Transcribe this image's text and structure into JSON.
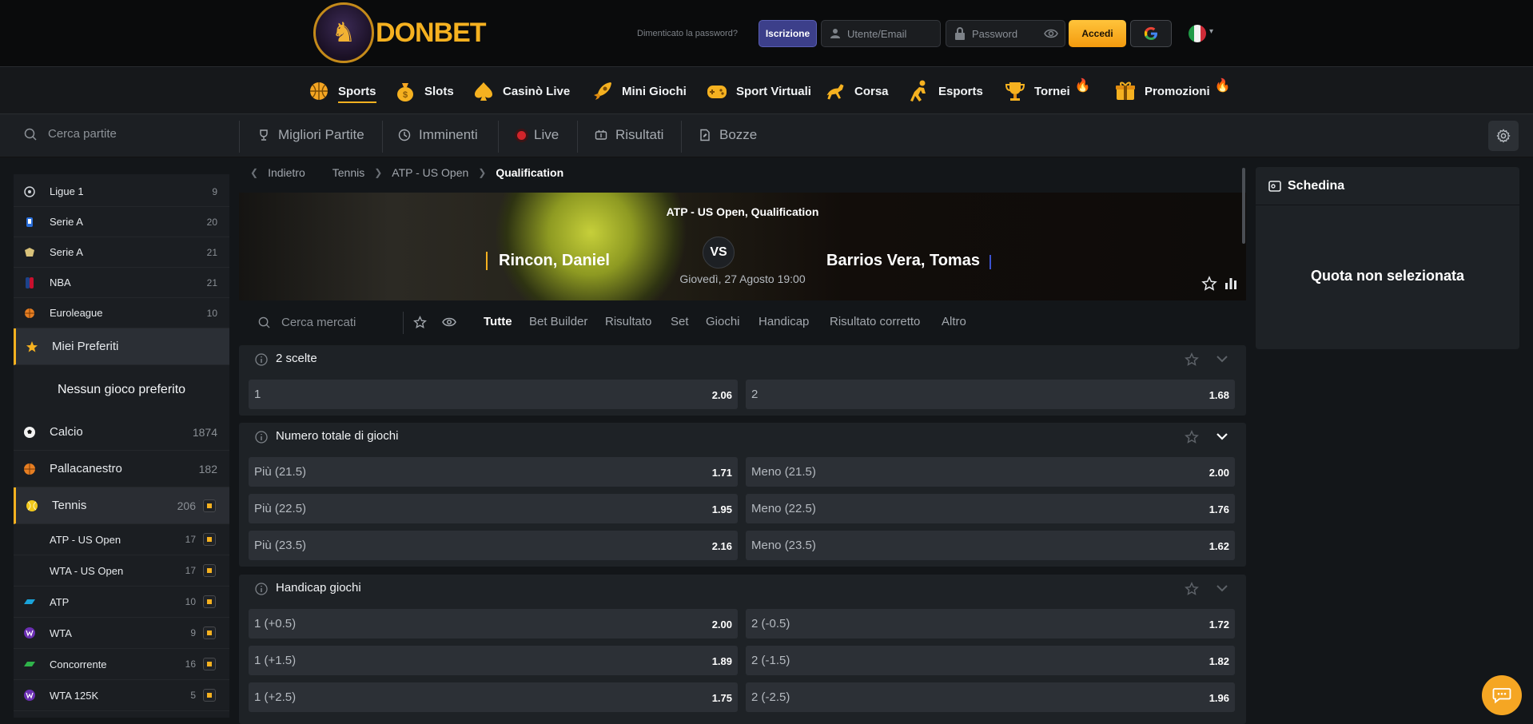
{
  "header": {
    "logo_text": "DONBET",
    "forgot_password": "Dimenticato la password?",
    "register_label": "Iscrizione",
    "user_placeholder": "Utente/Email",
    "password_placeholder": "Password",
    "login_label": "Accedi",
    "brand_color": "#f5b120"
  },
  "mainnav": {
    "items": [
      {
        "label": "Sports",
        "icon": "basketball-icon"
      },
      {
        "label": "Slots",
        "icon": "money-bag-icon"
      },
      {
        "label": "Casinò Live",
        "icon": "spade-icon"
      },
      {
        "label": "Mini Giochi",
        "icon": "rocket-icon"
      },
      {
        "label": "Sport Virtuali",
        "icon": "gamepad-icon"
      },
      {
        "label": "Corsa",
        "icon": "horse-icon"
      },
      {
        "label": "Esports",
        "icon": "player-icon"
      },
      {
        "label": "Tornei",
        "icon": "trophy-icon"
      },
      {
        "label": "Promozioni",
        "icon": "gift-icon"
      }
    ]
  },
  "subnav": {
    "search_placeholder": "Cerca partite",
    "items": [
      {
        "label": "Migliori Partite"
      },
      {
        "label": "Imminenti"
      },
      {
        "label": "Live"
      },
      {
        "label": "Risultati"
      },
      {
        "label": "Bozze"
      }
    ]
  },
  "sidebar": {
    "leagues": [
      {
        "name": "Ligue 1",
        "count": "9"
      },
      {
        "name": "Serie A",
        "count": "20"
      },
      {
        "name": "Serie A",
        "count": "21"
      },
      {
        "name": "NBA",
        "count": "21"
      },
      {
        "name": "Euroleague",
        "count": "10"
      }
    ],
    "favorites_label": "Miei Preferiti",
    "no_favorites": "Nessun gioco preferito",
    "sports": [
      {
        "name": "Calcio",
        "count": "1874"
      },
      {
        "name": "Pallacanestro",
        "count": "182"
      },
      {
        "name": "Tennis",
        "count": "206"
      }
    ],
    "tennis_leagues": [
      {
        "name": "ATP - US Open",
        "count": "17"
      },
      {
        "name": "WTA - US Open",
        "count": "17"
      },
      {
        "name": "ATP",
        "count": "10"
      },
      {
        "name": "WTA",
        "count": "9"
      },
      {
        "name": "Concorrente",
        "count": "16"
      },
      {
        "name": "WTA 125K",
        "count": "5"
      }
    ]
  },
  "breadcrumb": {
    "back": "Indietro",
    "items": [
      "Tennis",
      "ATP - US Open",
      "Qualification"
    ]
  },
  "event": {
    "league": "ATP - US Open, Qualification",
    "home": "Rincon, Daniel",
    "away": "Barrios Vera, Tomas",
    "vs": "VS",
    "date": "Giovedì, 27 Agosto 19:00"
  },
  "markets_bar": {
    "search_placeholder": "Cerca mercati",
    "tabs": [
      "Tutte",
      "Bet Builder",
      "Risultato",
      "Set",
      "Giochi",
      "Handicap",
      "Risultato corretto",
      "Altro"
    ]
  },
  "markets": [
    {
      "title": "2 scelte",
      "rows": [
        [
          {
            "label": "1",
            "odd": "2.06"
          },
          {
            "label": "2",
            "odd": "1.68"
          }
        ]
      ]
    },
    {
      "title": "Numero totale di giochi",
      "rows": [
        [
          {
            "label": "Più (21.5)",
            "odd": "1.71"
          },
          {
            "label": "Meno (21.5)",
            "odd": "2.00"
          }
        ],
        [
          {
            "label": "Più (22.5)",
            "odd": "1.95"
          },
          {
            "label": "Meno (22.5)",
            "odd": "1.76"
          }
        ],
        [
          {
            "label": "Più (23.5)",
            "odd": "2.16"
          },
          {
            "label": "Meno (23.5)",
            "odd": "1.62"
          }
        ]
      ]
    },
    {
      "title": "Handicap giochi",
      "rows": [
        [
          {
            "label": "1 (+0.5)",
            "odd": "2.00"
          },
          {
            "label": "2 (-0.5)",
            "odd": "1.72"
          }
        ],
        [
          {
            "label": "1 (+1.5)",
            "odd": "1.89"
          },
          {
            "label": "2 (-1.5)",
            "odd": "1.82"
          }
        ],
        [
          {
            "label": "1 (+2.5)",
            "odd": "1.75"
          },
          {
            "label": "2 (-2.5)",
            "odd": "1.96"
          }
        ]
      ]
    }
  ],
  "betslip": {
    "title": "Schedina",
    "empty": "Quota non selezionata"
  }
}
